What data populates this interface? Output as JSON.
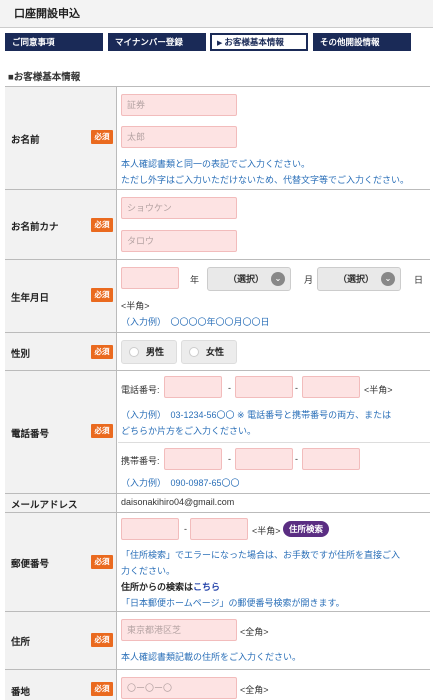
{
  "page": {
    "title": "口座開設申込"
  },
  "tabs": [
    {
      "label": "ご同意事項"
    },
    {
      "label": "マイナンバー登録"
    },
    {
      "label": "お客様基本情報",
      "mark": "▶"
    },
    {
      "label": "その他開設情報"
    }
  ],
  "section": {
    "title": "■お客様基本情報"
  },
  "required_label": "必須",
  "name": {
    "label": "お名前",
    "last_placeholder": "証券",
    "first_placeholder": "太郎",
    "note1": "本人確認書類と同一の表記でご入力ください。",
    "note2": "ただし外字はご入力いただけないため、代替文字等でご入力ください。"
  },
  "kana": {
    "label": "お名前カナ",
    "last_placeholder": "ショウケン",
    "first_placeholder": "タロウ"
  },
  "birth": {
    "label": "生年月日",
    "year_unit": "年",
    "month_select": "（選択）",
    "month_unit": "月",
    "day_select": "（選択）",
    "day_unit": "日",
    "halfwidth": "<半角>",
    "example": "（入力例）　〇〇〇〇年〇〇月〇〇日"
  },
  "gender": {
    "label": "性別",
    "male": "男性",
    "female": "女性"
  },
  "phone": {
    "label": "電話番号",
    "tel_label": "電話番号:",
    "dash": "-",
    "halfwidth": "<半角>",
    "tel_example": "（入力例）　03-1234-56〇〇 ※ 電話番号と携帯番号の両方、または",
    "tel_note": "どちらか片方をご入力ください。",
    "mobile_label": "携帯番号:",
    "mobile_example": "（入力例）　090-0987-65〇〇"
  },
  "email": {
    "label": "メールアドレス",
    "value": "daisonakihiro04@gmail.com"
  },
  "postal": {
    "label": "郵便番号",
    "dash": "-",
    "halfwidth": "<半角>",
    "search_button": "住所検索",
    "note1": "「住所検索」でエラーになった場合は、お手数ですが住所を直接ご入",
    "note2": "力ください。",
    "search_from": "住所からの検索は",
    "search_link": "こちら",
    "note3": "「日本郵便ホームページ」の郵便番号検索が開きます。"
  },
  "address": {
    "label": "住所",
    "placeholder": "東京都港区芝",
    "fullwidth": "<全角>",
    "note": "本人確認書類記載の住所をご入力ください。"
  },
  "banchi": {
    "label": "番地",
    "placeholder": "〇ー〇ー〇",
    "fullwidth": "<全角>"
  }
}
